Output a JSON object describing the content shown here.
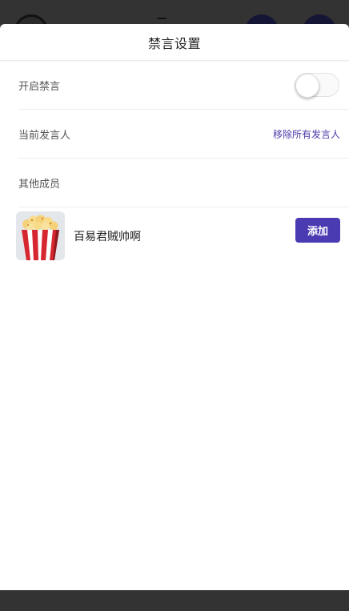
{
  "dialog": {
    "title": "禁言设置"
  },
  "settings": {
    "mute_label": "开启禁言",
    "mute_enabled": false,
    "current_speaker_label": "当前发言人",
    "remove_all_label": "移除所有发言人",
    "other_members_label": "其他成员"
  },
  "members": [
    {
      "name": "百易君贼帅啊",
      "avatar_icon": "popcorn-icon",
      "action_label": "添加"
    }
  ],
  "colors": {
    "accent": "#4b3bb2",
    "link": "#4a3aa8"
  }
}
